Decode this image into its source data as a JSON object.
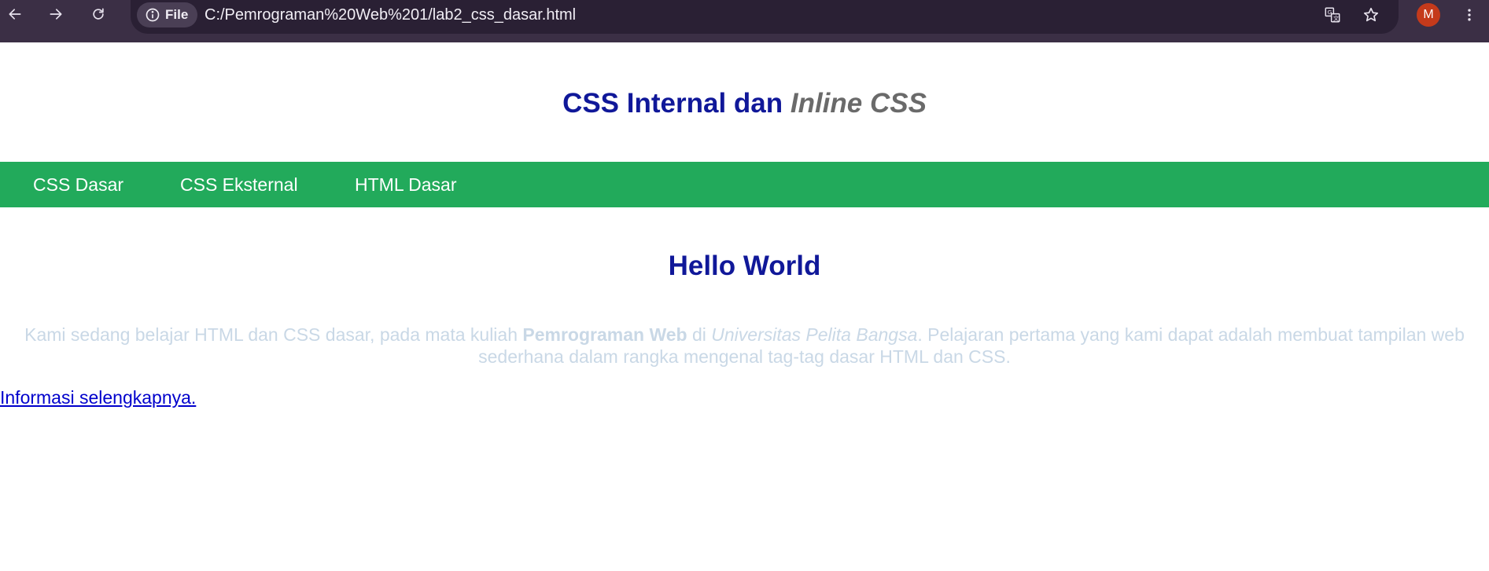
{
  "browser": {
    "site_info_label": "File",
    "url": "C:/Pemrograman%20Web%201/lab2_css_dasar.html",
    "profile_initial": "M",
    "colors": {
      "frame": "#3b2f45",
      "omnibox": "#2a2034",
      "avatar": "#c43a1b"
    },
    "icons": [
      "back-arrow-icon",
      "forward-arrow-icon",
      "reload-icon",
      "info-icon",
      "translate-icon",
      "star-icon",
      "three-dots-icon"
    ]
  },
  "header": {
    "title_plain": "CSS Internal dan ",
    "title_italic": "Inline CSS",
    "title_color": "#101899",
    "italic_color": "#6a6a6a"
  },
  "nav": {
    "background": "#22aa5b",
    "items": [
      {
        "label": "CSS Dasar"
      },
      {
        "label": "CSS Eksternal"
      },
      {
        "label": "HTML Dasar"
      }
    ]
  },
  "content": {
    "title": "Hello World",
    "paragraph": {
      "part1": "Kami sedang belajar HTML dan CSS dasar, pada mata kuliah ",
      "bold": "Pemrograman Web",
      "part2": " di ",
      "italic": "Universitas Pelita Bangsa",
      "part3": ". Pelajaran pertama yang kami dapat adalah membuat tampilan web sederhana dalam rangka mengenal tag-tag dasar HTML dan CSS.",
      "color": "#c9d8e6"
    },
    "link_text": "Informasi selengkapnya."
  }
}
